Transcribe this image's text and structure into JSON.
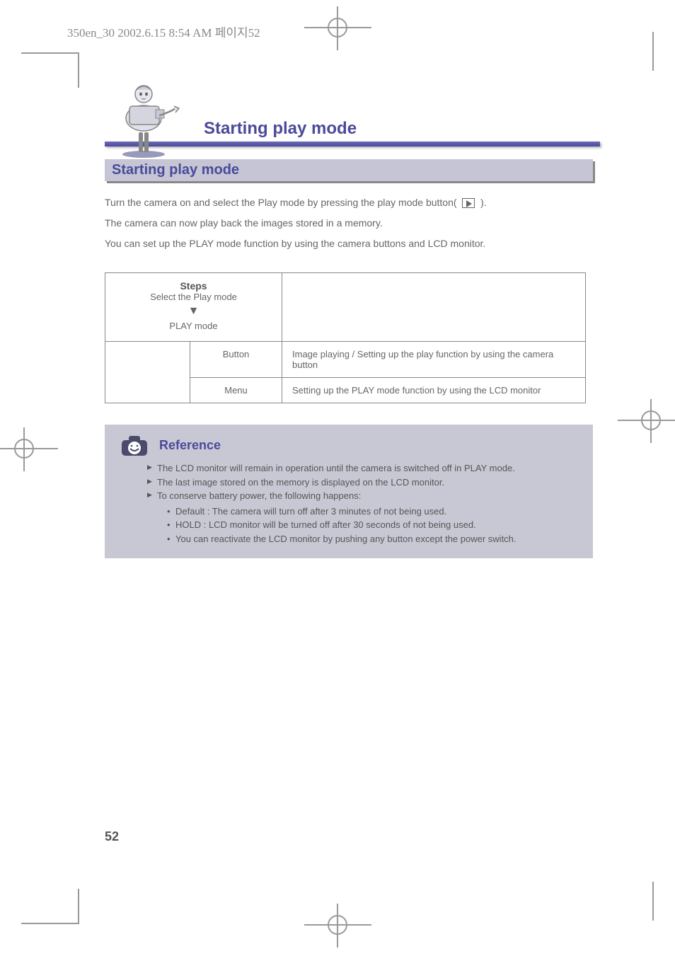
{
  "header": {
    "file_info": "350en_30  2002.6.15 8:54 AM  페이지52"
  },
  "chapter_title": "Starting play mode",
  "section_title": "Starting play mode",
  "intro": {
    "line1_pre": "Turn the camera on and select the Play mode by pressing the play mode button(         ).",
    "line2": "The camera can now play back the images stored in a memory.",
    "line3": "You can set up the PLAY mode function by using the camera buttons and LCD monitor."
  },
  "table": {
    "steps_label": "Steps",
    "cell_1": "Select the Play mode",
    "arrow": "▼",
    "cell_2": "PLAY mode",
    "row2_a": "Button",
    "row2_b": "Image playing / Setting up the play function by using the camera button",
    "row3_a": "Menu",
    "row3_b": "Setting up the PLAY mode function by using the LCD monitor"
  },
  "reference": {
    "title": "Reference",
    "items": [
      "The LCD monitor will remain in operation until the camera is switched off in PLAY mode.",
      "The last image stored on the memory is displayed on the LCD monitor.",
      "To conserve battery power, the following happens:"
    ],
    "subitems": [
      "Default : The camera will turn off after 3 minutes of not being used.",
      "HOLD    : LCD monitor will be turned off after 30 seconds of not being used.",
      "You can reactivate the LCD monitor by pushing any button except the power switch."
    ]
  },
  "page_number": "52"
}
